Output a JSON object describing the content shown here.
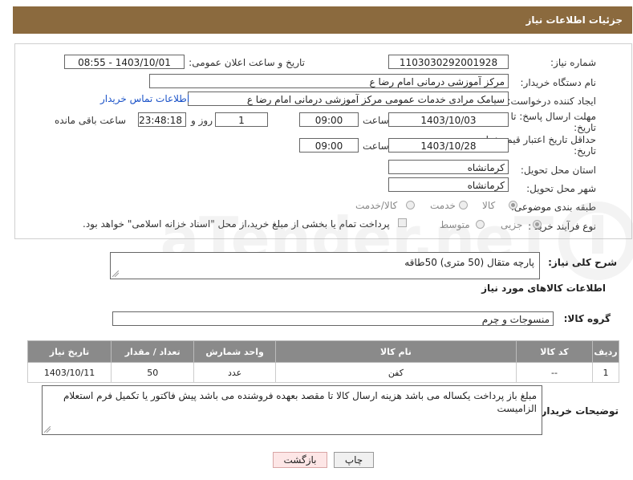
{
  "header": {
    "title": "جزئیات اطلاعات نیاز"
  },
  "form": {
    "need_number_label": "شماره نیاز:",
    "need_number": "1103030292001928",
    "announce_label": "تاریخ و ساعت اعلان عمومی:",
    "announce_value": "1403/10/01 - 08:55",
    "buyer_org_label": "نام دستگاه خریدار:",
    "buyer_org": "مرکز آموزشی  درمانی امام رضا  ع",
    "requester_label": "ایجاد کننده درخواست:",
    "requester": "سیامک مرادی خدمات عمومی مرکز آموزشی  درمانی امام رضا  ع",
    "contact_link": "اطلاعات تماس خریدار",
    "reply_deadline_label": "مهلت ارسال پاسخ: تا",
    "reply_deadline_label2": "تاریخ:",
    "reply_date": "1403/10/03",
    "time_label": "ساعت",
    "reply_time": "09:00",
    "days_value": "1",
    "days_label": "روز و",
    "remaining_value": "23:48:18",
    "remaining_label": "ساعت باقی مانده",
    "validity_label": "حداقل تاریخ اعتبار قیمت: تا",
    "validity_label2": "تاریخ:",
    "validity_date": "1403/10/28",
    "validity_time": "09:00",
    "province_label": "استان محل تحویل:",
    "province": "کرمانشاه",
    "city_label": "شهر محل تحویل:",
    "city": "کرمانشاه",
    "category_label": "طبقه بندی موضوعی:",
    "category_options": [
      "کالا",
      "خدمت",
      "کالا/خدمت"
    ],
    "process_label": "نوع فرآیند خرید :",
    "process_options": [
      "جزیی",
      "متوسط"
    ],
    "payment_note": "پرداخت تمام یا بخشی از مبلغ خرید،از محل \"اسناد خزانه اسلامی\" خواهد بود."
  },
  "watermark": {
    "text": "AriaTender.neT"
  },
  "description": {
    "label": "شرح کلی نیاز:",
    "value": "پارچه متقال (50 متری)   50طاقه"
  },
  "goods_info_title": "اطلاعات کالاهای مورد نیاز",
  "goods_group": {
    "label": "گروه کالا:",
    "value": "منسوجات و چرم"
  },
  "table": {
    "headers": [
      "ردیف",
      "کد کالا",
      "نام کالا",
      "واحد شمارش",
      "تعداد / مقدار",
      "تاریخ نیاز"
    ],
    "rows": [
      [
        "1",
        "--",
        "کفن",
        "عدد",
        "50",
        "1403/10/11"
      ]
    ]
  },
  "buyer_notes": {
    "label": "توضیحات خریدار:",
    "value": "مبلغ باز پرداخت یکساله می باشد هزینه ارسال کالا تا مقصد بعهده فروشنده می باشد پیش فاکتور یا تکمیل فرم استعلام الزامیست"
  },
  "buttons": {
    "print": "چاپ",
    "back": "بازگشت"
  },
  "colors": {
    "header": "#8b6a3e",
    "table_header": "#8a8a8a",
    "link": "#1a52c8",
    "back_button": "#fde6e6"
  }
}
